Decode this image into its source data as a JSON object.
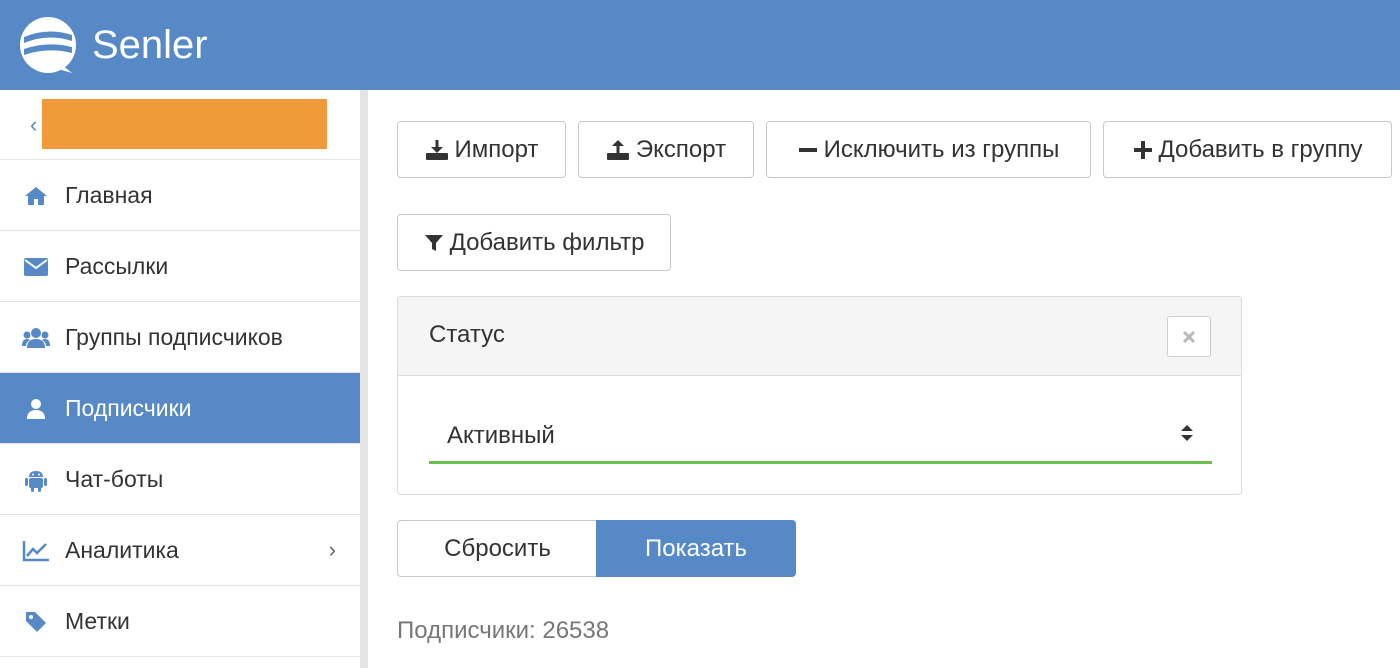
{
  "app": {
    "name": "Senler"
  },
  "sidebar": {
    "back_icon": "chevron-left-icon",
    "project_name_redacted": true,
    "items": [
      {
        "label": "Главная",
        "icon": "home-icon",
        "active": false
      },
      {
        "label": "Рассылки",
        "icon": "envelope-icon",
        "active": false
      },
      {
        "label": "Группы подписчиков",
        "icon": "users-icon",
        "active": false
      },
      {
        "label": "Подписчики",
        "icon": "user-icon",
        "active": true
      },
      {
        "label": "Чат-боты",
        "icon": "android-icon",
        "active": false
      },
      {
        "label": "Аналитика",
        "icon": "line-chart-icon",
        "active": false,
        "has_submenu": true
      },
      {
        "label": "Метки",
        "icon": "tag-icon",
        "active": false
      }
    ]
  },
  "toolbar": {
    "import_label": "Импорт",
    "export_label": "Экспорт",
    "exclude_label": "Исключить из группы",
    "add_label": "Добавить в группу",
    "add_filter_label": "Добавить фильтр"
  },
  "filter": {
    "title": "Статус",
    "selected_value": "Активный"
  },
  "actions": {
    "reset_label": "Сбросить",
    "show_label": "Показать"
  },
  "summary": {
    "subscribers_text": "Подписчики: 26538"
  },
  "colors": {
    "brand": "#5689c6",
    "project_highlight": "#f19a39",
    "select_underline": "#6cbf51"
  }
}
